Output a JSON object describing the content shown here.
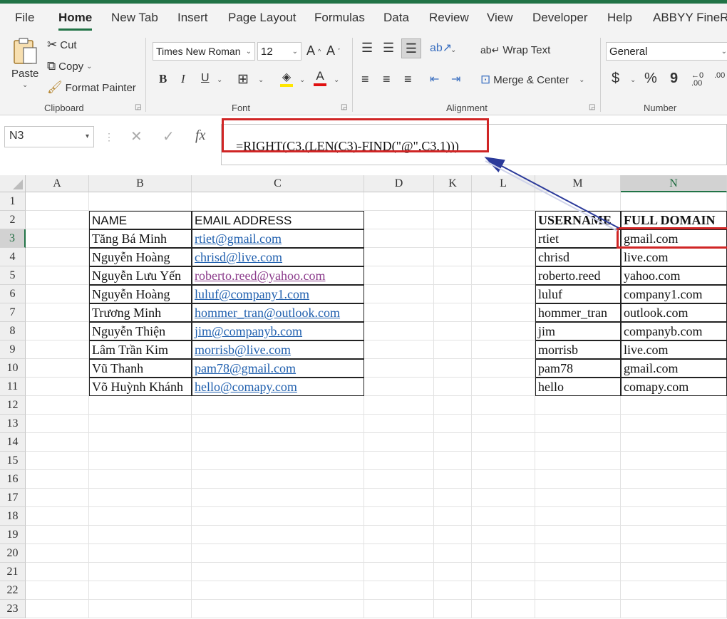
{
  "tabs": [
    "File",
    "Home",
    "New Tab",
    "Insert",
    "Page Layout",
    "Formulas",
    "Data",
    "Review",
    "View",
    "Developer",
    "Help",
    "ABBYY FineRe"
  ],
  "active_tab": "Home",
  "clipboard": {
    "paste": "Paste",
    "cut": "Cut",
    "copy": "Copy",
    "format_painter": "Format Painter",
    "label": "Clipboard"
  },
  "font": {
    "name": "Times New Roman",
    "size": "12",
    "label": "Font",
    "bold": "B",
    "italic": "I",
    "underline": "U"
  },
  "alignment": {
    "wrap": "Wrap Text",
    "merge": "Merge & Center",
    "label": "Alignment"
  },
  "number": {
    "format": "General",
    "currency": "$",
    "percent": "%",
    "comma": "9",
    "label": "Number"
  },
  "namebox": "N3",
  "formula": "=RIGHT(C3,(LEN(C3)-FIND(\"@\",C3,1)))",
  "columns": [
    "A",
    "B",
    "C",
    "D",
    "K",
    "L",
    "M",
    "N"
  ],
  "rows": [
    "1",
    "2",
    "3",
    "4",
    "5",
    "6",
    "7",
    "8",
    "9",
    "10",
    "11",
    "12",
    "13",
    "14",
    "15",
    "16",
    "17",
    "18",
    "19",
    "20",
    "21",
    "22",
    "23"
  ],
  "table_left": {
    "headers": [
      "NAME",
      "EMAIL ADDRESS"
    ],
    "rows": [
      [
        "Tăng Bá Minh",
        "rtiet@gmail.com"
      ],
      [
        "Nguyễn Hoàng",
        "chrisd@live.com"
      ],
      [
        "Nguyễn Lưu Yến",
        "roberto.reed@yahoo.com"
      ],
      [
        "Nguyễn Hoàng",
        "luluf@company1.com"
      ],
      [
        "Trương Minh",
        "hommer_tran@outlook.com"
      ],
      [
        "Nguyễn Thiện",
        "jim@companyb.com"
      ],
      [
        "Lâm Trần Kim",
        "morrisb@live.com"
      ],
      [
        "Vũ Thanh",
        "pam78@gmail.com"
      ],
      [
        "Võ Huỳnh Khánh",
        "hello@comapy.com"
      ]
    ]
  },
  "table_right": {
    "headers": [
      "USERNAME",
      "FULL DOMAIN"
    ],
    "rows": [
      [
        "rtiet",
        "gmail.com"
      ],
      [
        "chrisd",
        "live.com"
      ],
      [
        "roberto.reed",
        "yahoo.com"
      ],
      [
        "luluf",
        "company1.com"
      ],
      [
        "hommer_tran",
        "outlook.com"
      ],
      [
        "jim",
        "companyb.com"
      ],
      [
        "morrisb",
        "live.com"
      ],
      [
        "pam78",
        "gmail.com"
      ],
      [
        "hello",
        "comapy.com"
      ]
    ]
  },
  "colors": {
    "accent": "#217346",
    "highlight": "#d02525",
    "link": "#1f5fae",
    "visited": "#8b3b8b",
    "arrow": "#2b3a9a"
  }
}
